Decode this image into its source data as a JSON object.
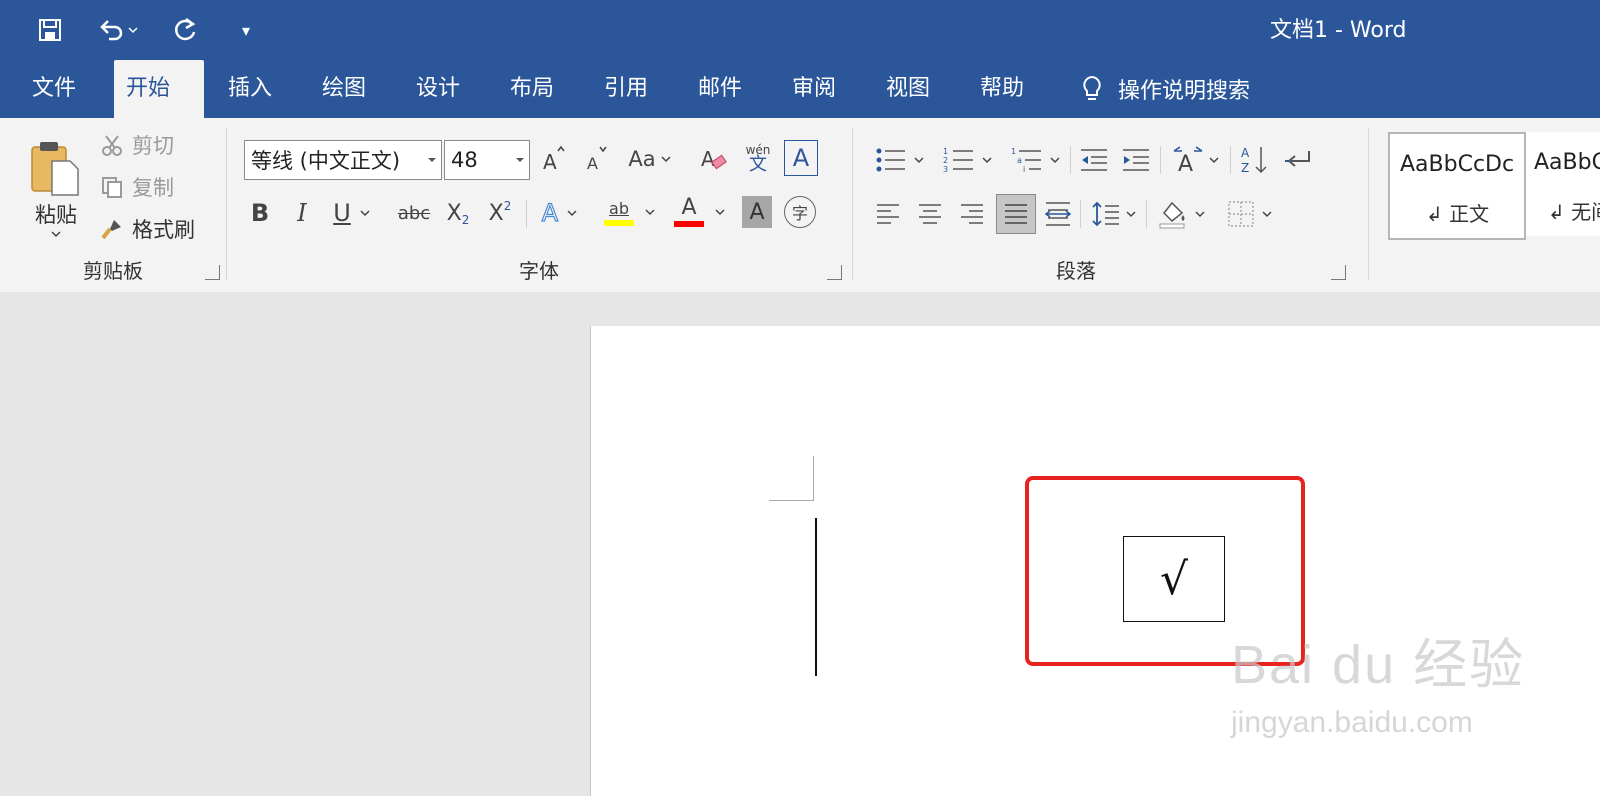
{
  "window": {
    "title": "文档1  -  Word"
  },
  "quick_access": {
    "more": "▾"
  },
  "tabs": [
    {
      "label": "文件"
    },
    {
      "label": "开始"
    },
    {
      "label": "插入"
    },
    {
      "label": "绘图"
    },
    {
      "label": "设计"
    },
    {
      "label": "布局"
    },
    {
      "label": "引用"
    },
    {
      "label": "邮件"
    },
    {
      "label": "审阅"
    },
    {
      "label": "视图"
    },
    {
      "label": "帮助"
    }
  ],
  "search": {
    "label": "操作说明搜索"
  },
  "clipboard": {
    "paste": "粘贴",
    "cut": "剪切",
    "copy": "复制",
    "format_painter": "格式刷",
    "group_label": "剪贴板"
  },
  "font": {
    "name": "等线 (中文正文)",
    "size": "48",
    "change_case": "Aa",
    "phonetic_top": "wén",
    "phonetic_bottom": "文",
    "border_char": "A",
    "bold": "B",
    "italic": "I",
    "underline": "U",
    "strike": "abc",
    "subscript": "X",
    "subscript_small": "2",
    "superscript": "X",
    "superscript_small": "2",
    "effects": "A",
    "highlight": "ab",
    "font_color": "A",
    "shading": "A",
    "enclose": "字",
    "group_label": "字体",
    "highlight_color": "#ffff00",
    "font_color_bar": "#ff0000"
  },
  "paragraph": {
    "group_label": "段落"
  },
  "styles": [
    {
      "sample": "AaBbCcDc",
      "name": "↲ 正文"
    },
    {
      "sample": "AaBbC",
      "name": "↲ 无间"
    }
  ],
  "document": {
    "symbol": "√"
  },
  "watermark": {
    "brand": "Bai du 经验",
    "url": "jingyan.baidu.com"
  }
}
